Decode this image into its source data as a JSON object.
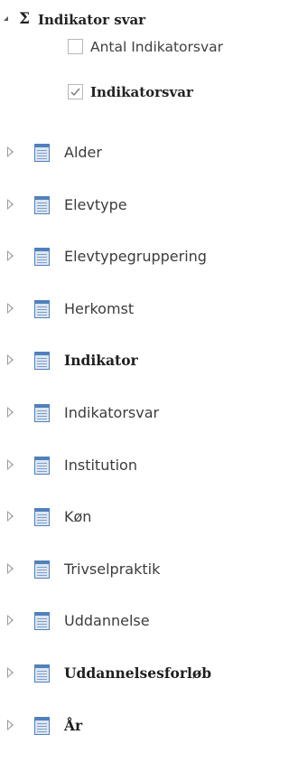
{
  "measure_group": {
    "title": "Indikator svar",
    "expanded": true,
    "icon": "sigma-icon",
    "items": [
      {
        "label": "Antal Indikatorsvar",
        "checked": false,
        "bold": false
      },
      {
        "label": "Indikatorsvar",
        "checked": true,
        "bold": true
      }
    ]
  },
  "tables": [
    {
      "label": "Alder",
      "bold": false
    },
    {
      "label": "Elevtype",
      "bold": false
    },
    {
      "label": "Elevtypegruppering",
      "bold": false
    },
    {
      "label": "Herkomst",
      "bold": false
    },
    {
      "label": "Indikator",
      "bold": true
    },
    {
      "label": "Indikatorsvar",
      "bold": false
    },
    {
      "label": "Institution",
      "bold": false
    },
    {
      "label": "Køn",
      "bold": false
    },
    {
      "label": "Trivselpraktik",
      "bold": false
    },
    {
      "label": "Uddannelse",
      "bold": false
    },
    {
      "label": "Uddannelsesforløb",
      "bold": true
    },
    {
      "label": "År",
      "bold": true
    }
  ],
  "colors": {
    "table_icon_fill": "#dce6f2",
    "table_icon_border": "#4f81bd",
    "check_mark": "#7a7a7a"
  }
}
